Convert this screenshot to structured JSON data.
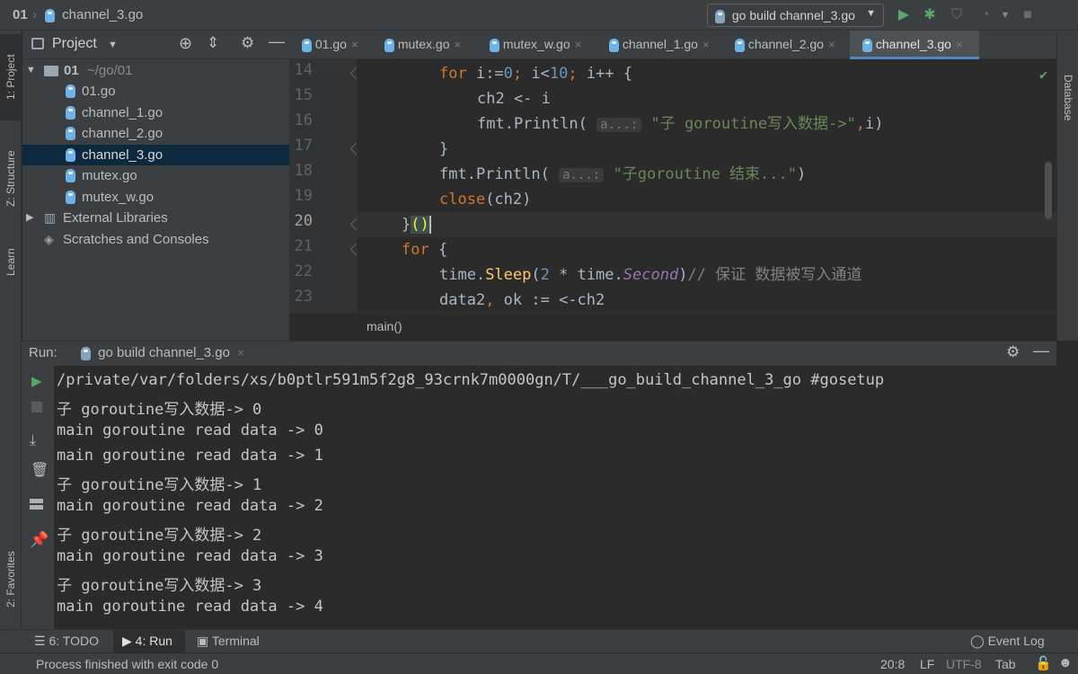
{
  "titlebar": {
    "project": "01",
    "file": "channel_3.go",
    "run_config": "go build channel_3.go"
  },
  "left_stripe": {
    "project": "1: Project",
    "structure": "Z: Structure",
    "learn": "Learn",
    "favorites": "2: Favorites"
  },
  "right_stripe": {
    "database": "Database"
  },
  "project_panel": {
    "title": "Project",
    "root_name": "01",
    "root_path": "~/go/01",
    "files": [
      "01.go",
      "channel_1.go",
      "channel_2.go",
      "channel_3.go",
      "mutex.go",
      "mutex_w.go"
    ],
    "selected": "channel_3.go",
    "external": "External Libraries",
    "scratches": "Scratches and Consoles"
  },
  "editor": {
    "tabs": [
      "01.go",
      "mutex.go",
      "mutex_w.go",
      "channel_1.go",
      "channel_2.go",
      "channel_3.go"
    ],
    "active_tab": "channel_3.go",
    "line_numbers": [
      "14",
      "15",
      "16",
      "17",
      "18",
      "19",
      "20",
      "21",
      "22",
      "23"
    ],
    "hint": "a...:",
    "str_16": "\"子 goroutine写入数据->\"",
    "str_18": "\"子goroutine 结束...\"",
    "comment_22": "// 保证 数据被写入通道",
    "breadcrumb": "main()"
  },
  "run_panel": {
    "label": "Run:",
    "tab": "go build channel_3.go",
    "lines": [
      "/private/var/folders/xs/b0ptlr591m5f2g8_93crnk7m0000gn/T/___go_build_channel_3_go #gosetup",
      "子 goroutine写入数据-> 0",
      "main goroutine read data -> 0",
      "main goroutine read data -> 1",
      "子 goroutine写入数据-> 1",
      "main goroutine read data -> 2",
      "子 goroutine写入数据-> 2",
      "main goroutine read data -> 3",
      "子 goroutine写入数据-> 3",
      "main goroutine read data -> 4"
    ]
  },
  "bottom_tabs": {
    "todo": "6: TODO",
    "run": "4: Run",
    "terminal": "Terminal",
    "event_log": "Event Log"
  },
  "status": {
    "message": "Process finished with exit code 0",
    "position": "20:8",
    "line_sep": "LF",
    "encoding": "UTF-8",
    "indent": "Tab"
  },
  "colors": {
    "accent": "#4a88c7",
    "run_green": "#59a869",
    "keyword": "#cc7832",
    "string": "#6a8759",
    "number": "#6897bb"
  }
}
